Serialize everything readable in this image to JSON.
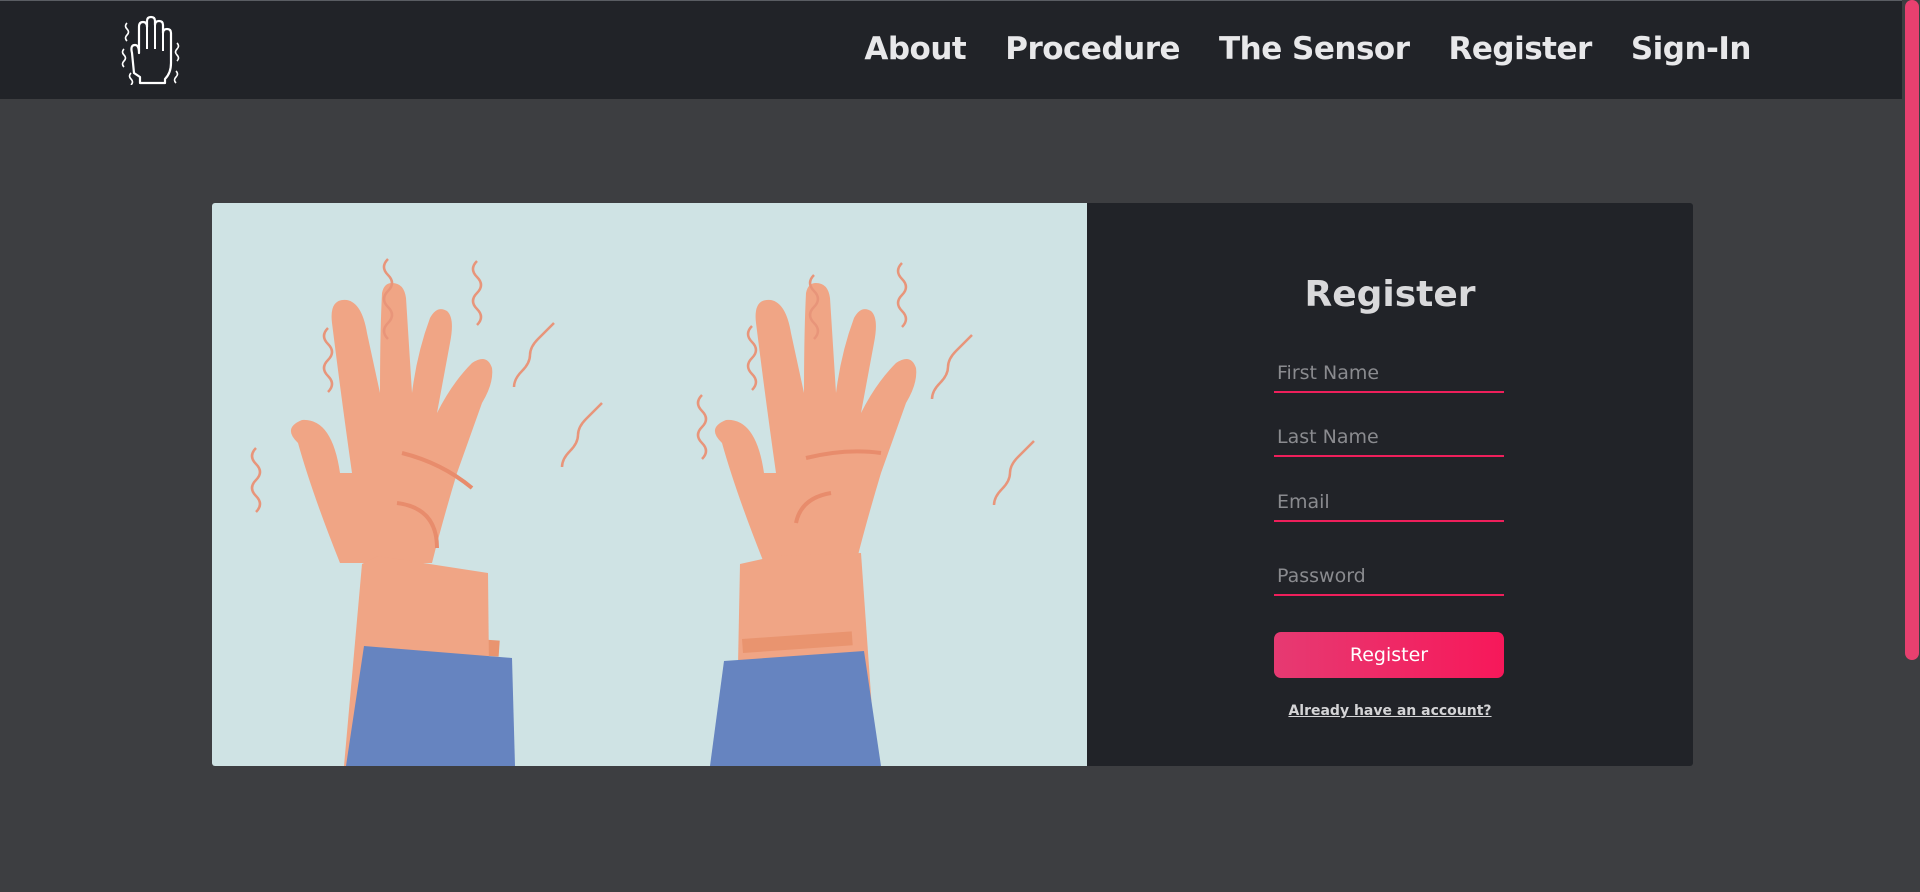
{
  "nav": {
    "logo_icon": "shaking-hand-icon",
    "links": [
      "About",
      "Procedure",
      "The Sensor",
      "Register",
      "Sign-In"
    ]
  },
  "hero": {
    "illustration": "trembling-hands-illustration"
  },
  "form": {
    "title": "Register",
    "first_name_placeholder": "First Name",
    "last_name_placeholder": "Last Name",
    "email_placeholder": "Email",
    "password_placeholder": "Password",
    "submit_label": "Register",
    "signin_link": "Already have an account?"
  },
  "colors": {
    "navbar_bg": "#212328",
    "page_bg": "#3d3e41",
    "accent": "#ee1f5b",
    "illustration_bg": "#cfe3e4",
    "skin": "#f0a585",
    "sleeve": "#6684c0"
  }
}
